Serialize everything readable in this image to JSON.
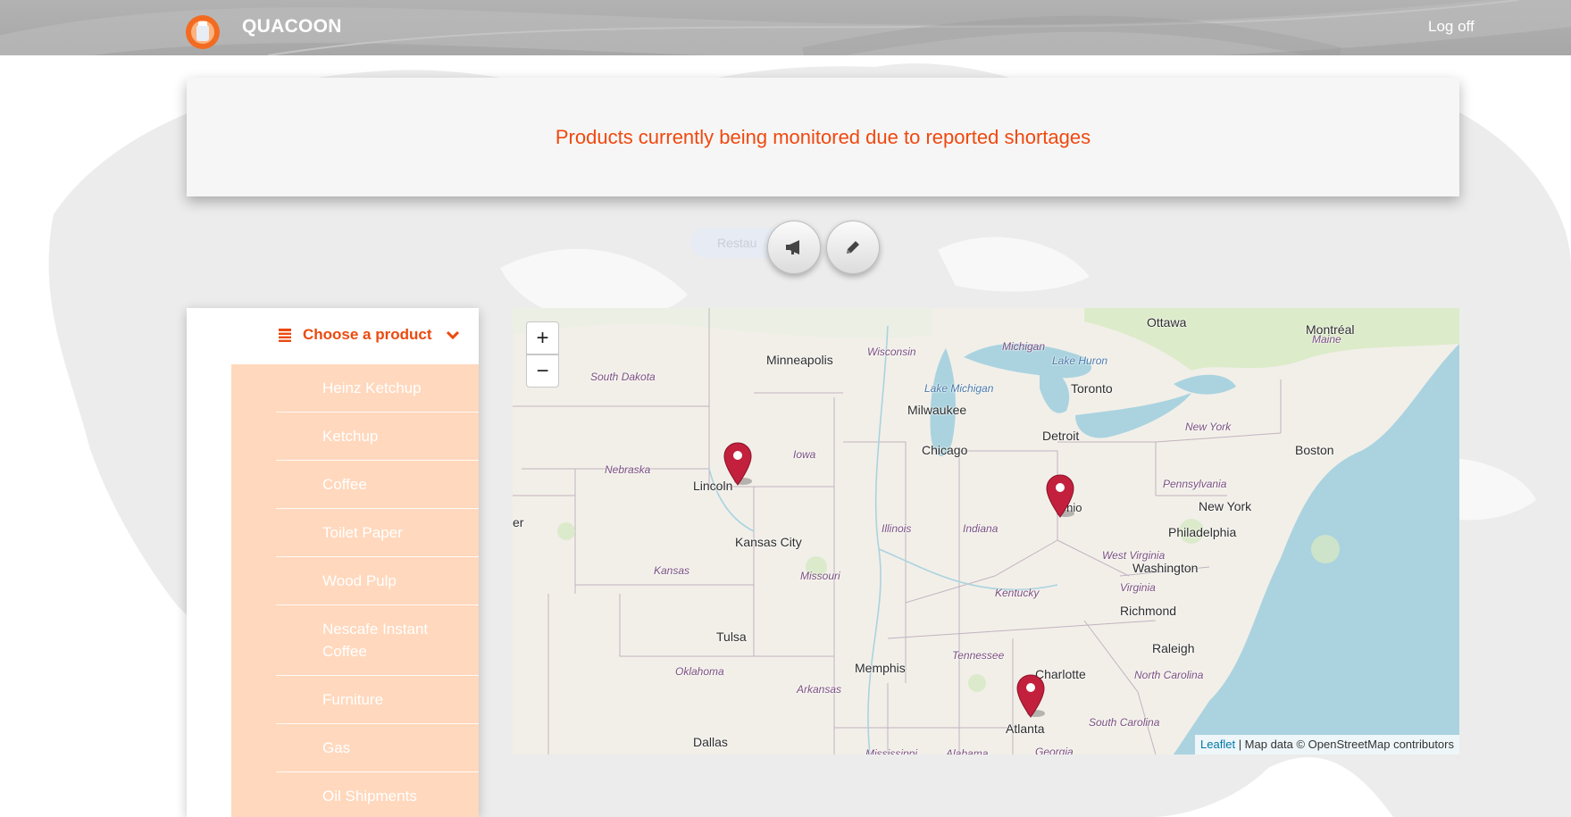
{
  "header": {
    "brand": "QUACOON",
    "logoff_label": "Log off"
  },
  "banner": {
    "text": "Products currently being monitored due to reported shortages"
  },
  "actions": {
    "ghost_label": "Restau",
    "announce_icon": "megaphone-icon",
    "edit_icon": "pencil-icon"
  },
  "sidebar": {
    "choose_label": "Choose a product",
    "products": [
      "Heinz Ketchup",
      "Ketchup",
      "Coffee",
      "Toilet Paper",
      "Wood Pulp",
      "Nescafe Instant Coffee",
      "Furniture",
      "Gas",
      "Oil Shipments"
    ]
  },
  "map": {
    "zoom_in": "+",
    "zoom_out": "−",
    "attribution_link": "Leaflet",
    "attribution_text": " | Map data © OpenStreetMap contributors",
    "cities": [
      "Ottawa",
      "Montréal",
      "Minneapolis",
      "Toronto",
      "Milwaukee",
      "Detroit",
      "Chicago",
      "Boston",
      "Lincoln",
      "Kansas City",
      "New York",
      "Philadelphia",
      "Washington",
      "Richmond",
      "Tulsa",
      "Memphis",
      "Charlotte",
      "Raleigh",
      "Atlanta",
      "Dallas",
      "er",
      "Ohio"
    ],
    "states": [
      "South Dakota",
      "Wisconsin",
      "Michigan",
      "Maine",
      "Iowa",
      "Nebraska",
      "Pennsylvania",
      "New York",
      "Illinois",
      "Indiana",
      "Kansas",
      "Missouri",
      "West Virginia",
      "Virginia",
      "Kentucky",
      "Oklahoma",
      "Tennessee",
      "Arkansas",
      "North Carolina",
      "South Carolina",
      "Georgia",
      "Mississippi",
      "Alabama"
    ],
    "lakes": [
      "Lake Michigan",
      "Lake Huron"
    ],
    "marker_count": 3
  },
  "colors": {
    "accent": "#f0480e",
    "list_bg": "#ffd1b1",
    "marker": "#c2203d",
    "water": "#aad3df"
  }
}
